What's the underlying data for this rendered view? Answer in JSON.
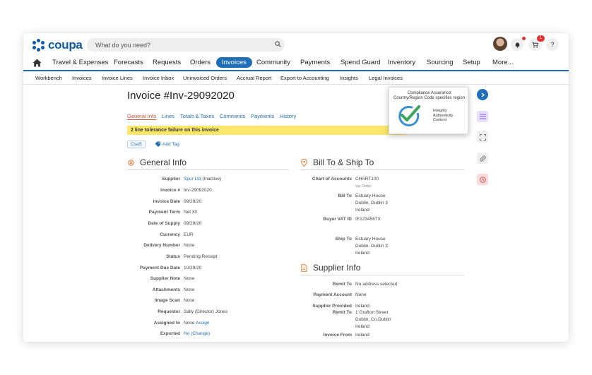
{
  "app": {
    "logo_text": "coupa"
  },
  "search": {
    "placeholder": "What do you need?"
  },
  "topbar": {
    "cart_count": "1",
    "help_label": "?"
  },
  "nav": {
    "items": [
      "Travel & Expenses",
      "Forecasts",
      "Requests",
      "Orders",
      "Invoices",
      "Community",
      "Payments",
      "Spend Guard",
      "Inventory",
      "Sourcing",
      "Setup",
      "More..."
    ],
    "active": "Invoices"
  },
  "subnav": {
    "items": [
      "Workbench",
      "Invoices",
      "Invoice Lines",
      "Invoice Inbox",
      "Uninvoiced Orders",
      "Accrual Report",
      "Export to Accounting",
      "Insights",
      "Legal Invoices"
    ]
  },
  "invoice": {
    "title": "Invoice #Inv-29092020",
    "tabs": [
      "General Info",
      "Lines",
      "Totals & Taxes",
      "Comments",
      "Payments",
      "History"
    ],
    "alert": "2 line tolerance failure on this invoice",
    "tag": "CsaS",
    "add_tag": "Add Tag"
  },
  "popup": {
    "title_line1": "Compliance Assurance",
    "title_line2": "Country/Region Code specifies region",
    "side_line1": "Integrity",
    "side_line2": "Authenticity",
    "side_line3": "Content"
  },
  "general_info": {
    "heading": "General Info",
    "fields": [
      {
        "label": "Supplier",
        "value": "Spur Ltd",
        "suffix": "(Inactive)"
      },
      {
        "label": "Invoice #",
        "value": "Inv-29092020"
      },
      {
        "label": "Invoice Date",
        "value": "09/29/20"
      },
      {
        "label": "Payment Term",
        "value": "Net 30"
      },
      {
        "label": "Date of Supply",
        "value": "09/29/20"
      },
      {
        "label": "Currency",
        "value": "EUR"
      },
      {
        "label": "Delivery Number",
        "value": "None"
      },
      {
        "label": "Status",
        "value": "Pending Receipt"
      },
      {
        "label": "Payment Due Date",
        "value": "10/29/20"
      },
      {
        "label": "Supplier Note",
        "value": "None"
      },
      {
        "label": "Attachments",
        "value": "None"
      },
      {
        "label": "Image Scan",
        "value": "None"
      },
      {
        "label": "Requester",
        "value": "Sally (Director) Jones"
      },
      {
        "label": "Assigned to",
        "value": "None",
        "action": "Assign"
      },
      {
        "label": "Exported",
        "value": "No",
        "action": "(Change)"
      }
    ]
  },
  "bill_ship": {
    "heading": "Bill To & Ship To",
    "chart_label": "Chart of Accounts",
    "chart_value": "CHART100",
    "chart_note": "via Order",
    "bill_label": "Bill To",
    "bill_lines": [
      "Estuary House",
      "Dublin, Dublin 3",
      "Ireland"
    ],
    "vat_label": "Buyer VAT ID",
    "vat_value": "IE1234567X",
    "ship_label": "Ship To",
    "ship_lines": [
      "Estuary House",
      "Dublin, Dublin 3",
      "Ireland"
    ]
  },
  "supplier_info": {
    "heading": "Supplier Info",
    "remit_label": "Remit To",
    "remit_value": "No address selected",
    "payacct_label": "Payment Account",
    "payacct_value": "None",
    "provided_label": "Supplier Provided",
    "provided_value": "Ireland",
    "remit2_label": "Remit To",
    "remit2_lines": [
      "1 Grafton Street",
      "Dublin, Co.Dublin",
      "Ireland"
    ],
    "from_label": "Invoice From",
    "from_value": "Ireland"
  },
  "colors": {
    "brand": "#0d5ba8",
    "nav_active": "#1f6fb8",
    "alert": "#fde76a",
    "accent_orange": "#d4532a"
  }
}
